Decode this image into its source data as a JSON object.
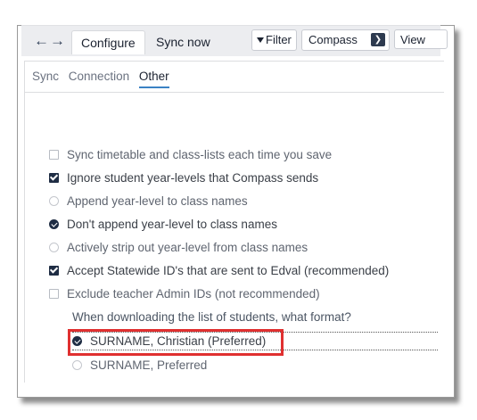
{
  "toolbar": {
    "nav_arrows": "←→",
    "tabs": [
      {
        "label": "Configure",
        "active": true
      },
      {
        "label": "Sync now",
        "active": false
      }
    ],
    "filter_label": "Filter",
    "source_select": "Compass",
    "view_label": "View"
  },
  "subtabs": [
    {
      "label": "Sync",
      "active": false
    },
    {
      "label": "Connection",
      "active": false
    },
    {
      "label": "Other",
      "active": true
    }
  ],
  "options": [
    {
      "type": "checkbox",
      "checked": false,
      "label": "Sync timetable and class-lists each time you save"
    },
    {
      "type": "checkbox",
      "checked": true,
      "label": "Ignore student year-levels that Compass sends"
    },
    {
      "type": "radio",
      "checked": false,
      "label": "Append year-level to class names"
    },
    {
      "type": "radio",
      "checked": true,
      "label": "Don't append year-level to class names"
    },
    {
      "type": "radio",
      "checked": false,
      "label": "Actively strip out year-level from class names"
    },
    {
      "type": "checkbox",
      "checked": true,
      "label": "Accept Statewide ID's that are sent to Edval (recommended)"
    },
    {
      "type": "checkbox",
      "checked": false,
      "label": "Exclude teacher Admin IDs (not recommended)"
    }
  ],
  "format_question": "When downloading the list of students, what format?",
  "format_options": [
    {
      "type": "radio",
      "checked": true,
      "label": "SURNAME, Christian (Preferred)",
      "highlighted": true
    },
    {
      "type": "radio",
      "checked": false,
      "label": "SURNAME, Preferred",
      "highlighted": false
    }
  ],
  "colors": {
    "accent": "#1f2d44",
    "highlight": "#e03030",
    "tab_underline": "#3b82c4"
  }
}
